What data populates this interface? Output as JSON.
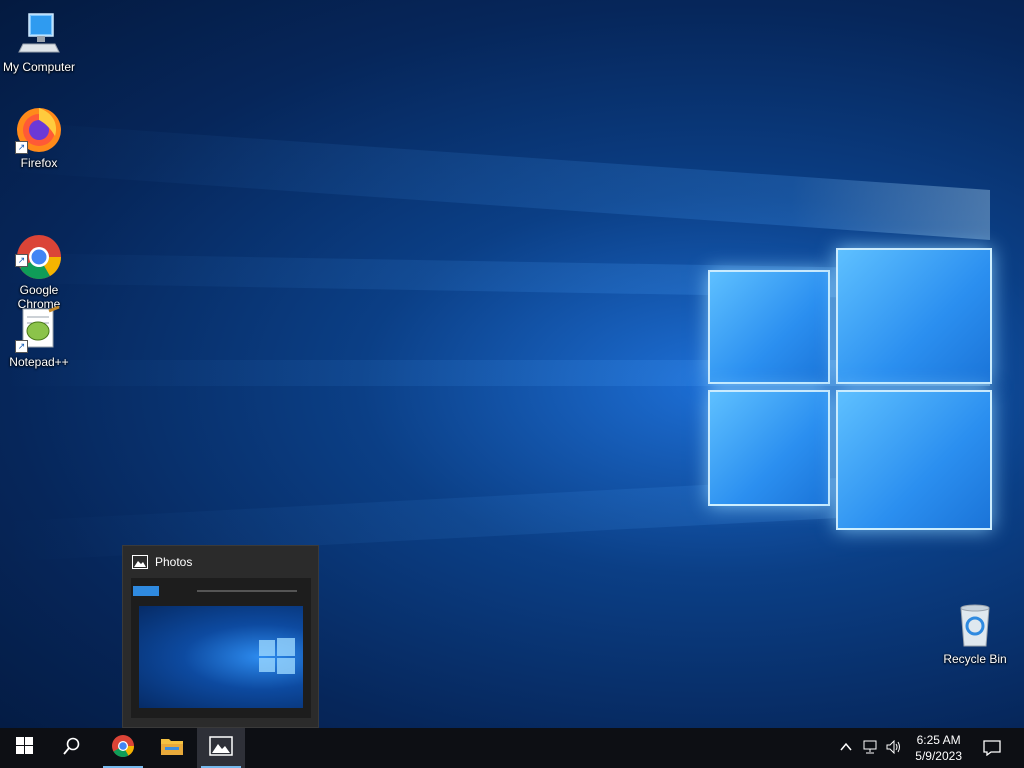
{
  "desktop": {
    "icons": [
      {
        "label": "My Computer",
        "icon": "computer-icon"
      },
      {
        "label": "Firefox",
        "icon": "firefox-icon"
      },
      {
        "label": "Google\nChrome",
        "icon": "chrome-icon"
      },
      {
        "label": "Notepad++",
        "icon": "notepad-plus-plus-icon"
      },
      {
        "label": "Recycle Bin",
        "icon": "recycle-bin-icon"
      }
    ]
  },
  "preview": {
    "title": "Photos",
    "icon": "photos-icon"
  },
  "taskbar": {
    "buttons": [
      {
        "name": "start",
        "icon": "windows-logo-icon"
      },
      {
        "name": "search",
        "icon": "search-icon"
      },
      {
        "name": "chrome",
        "icon": "chrome-icon"
      },
      {
        "name": "file-explorer",
        "icon": "folder-icon"
      },
      {
        "name": "photos",
        "icon": "photos-icon"
      }
    ],
    "clock": {
      "time": "6:25 AM",
      "date": "5/9/2023"
    }
  },
  "colors": {
    "taskbar": "#0d0f14",
    "accent": "#76b9ed",
    "desktop": "#0b3f86"
  }
}
